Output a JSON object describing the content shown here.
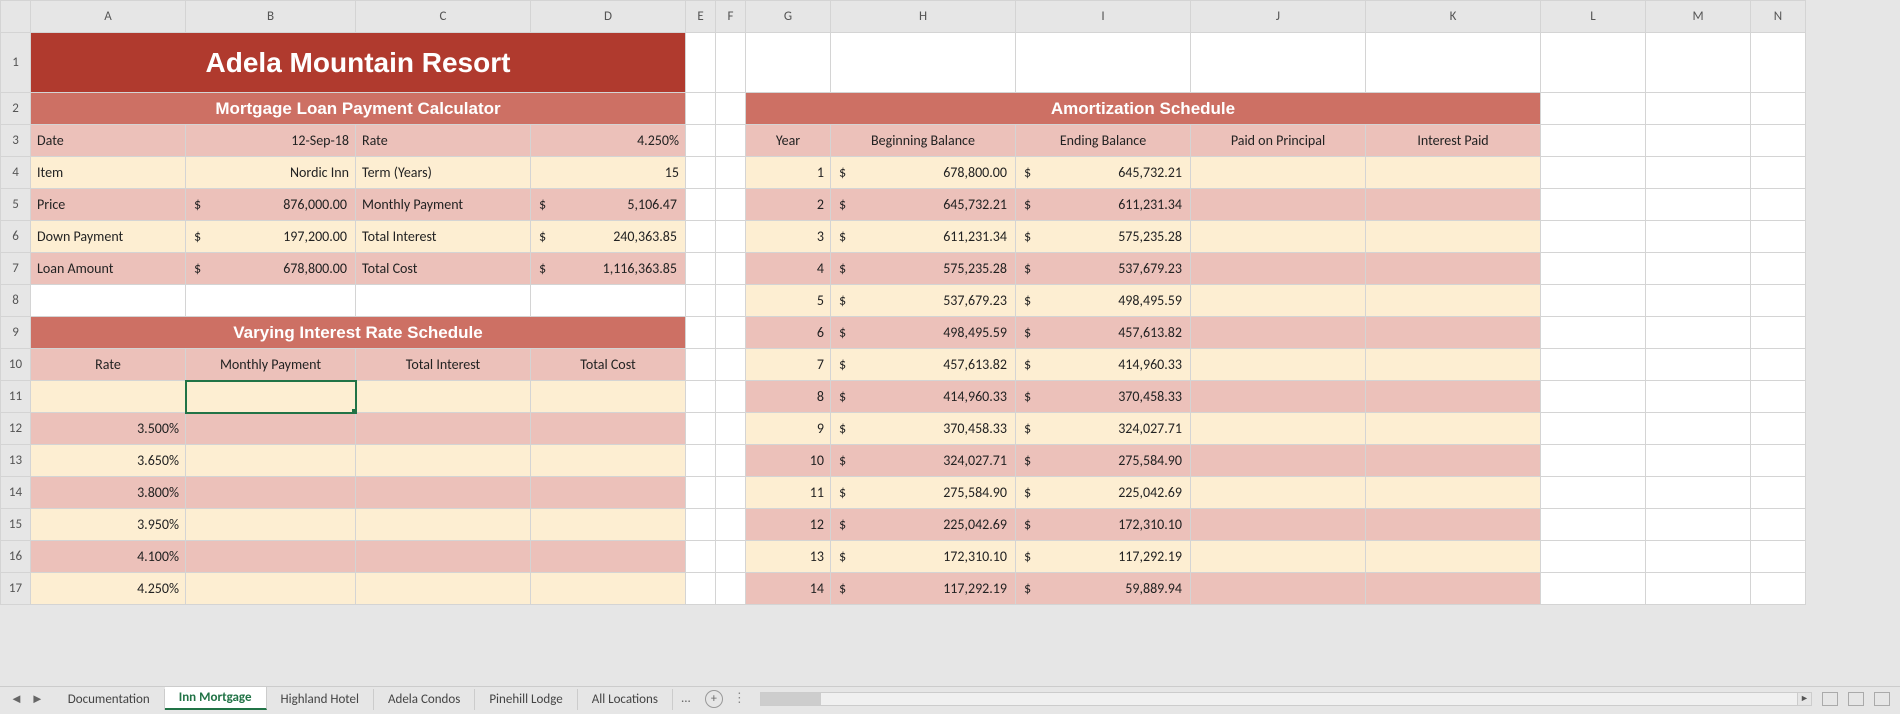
{
  "colHeaders": [
    "A",
    "B",
    "C",
    "D",
    "E",
    "F",
    "G",
    "H",
    "I",
    "J",
    "K",
    "L",
    "M",
    "N"
  ],
  "rowCount": 17,
  "title": "Adela Mountain Resort",
  "mortHeader": "Mortgage Loan Payment Calculator",
  "amortHeader": "Amortization Schedule",
  "varyHeader": "Varying Interest Rate Schedule",
  "labels": {
    "date": "Date",
    "rate": "Rate",
    "item": "Item",
    "term": "Term (Years)",
    "price": "Price",
    "monthly": "Monthly Payment",
    "down": "Down Payment",
    "totint": "Total Interest",
    "loan": "Loan Amount",
    "totcost": "Total Cost",
    "vrate": "Rate",
    "vmonthly": "Monthly Payment",
    "vtotint": "Total Interest",
    "vtotcost": "Total Cost",
    "year": "Year",
    "begbal": "Beginning Balance",
    "endbal": "Ending Balance",
    "paidprin": "Paid on Principal",
    "intpaid": "Interest Paid"
  },
  "mort": {
    "date": "12-Sep-18",
    "rate": "4.250%",
    "item": "Nordic Inn",
    "term": "15",
    "price": "876,000.00",
    "monthly": "5,106.47",
    "down": "197,200.00",
    "totint": "240,363.85",
    "loan": "678,800.00",
    "totcost": "1,116,363.85"
  },
  "rates": [
    "3.500%",
    "3.650%",
    "3.800%",
    "3.950%",
    "4.100%",
    "4.250%"
  ],
  "amort": [
    {
      "y": "1",
      "b": "678,800.00",
      "e": "645,732.21"
    },
    {
      "y": "2",
      "b": "645,732.21",
      "e": "611,231.34"
    },
    {
      "y": "3",
      "b": "611,231.34",
      "e": "575,235.28"
    },
    {
      "y": "4",
      "b": "575,235.28",
      "e": "537,679.23"
    },
    {
      "y": "5",
      "b": "537,679.23",
      "e": "498,495.59"
    },
    {
      "y": "6",
      "b": "498,495.59",
      "e": "457,613.82"
    },
    {
      "y": "7",
      "b": "457,613.82",
      "e": "414,960.33"
    },
    {
      "y": "8",
      "b": "414,960.33",
      "e": "370,458.33"
    },
    {
      "y": "9",
      "b": "370,458.33",
      "e": "324,027.71"
    },
    {
      "y": "10",
      "b": "324,027.71",
      "e": "275,584.90"
    },
    {
      "y": "11",
      "b": "275,584.90",
      "e": "225,042.69"
    },
    {
      "y": "12",
      "b": "225,042.69",
      "e": "172,310.10"
    },
    {
      "y": "13",
      "b": "172,310.10",
      "e": "117,292.19"
    },
    {
      "y": "14",
      "b": "117,292.19",
      "e": "59,889.94"
    }
  ],
  "tabs": [
    "Documentation",
    "Inn Mortgage",
    "Highland Hotel",
    "Adela Condos",
    "Pinehill Lodge",
    "All Locations"
  ],
  "activeTab": 1,
  "tabMore": "...",
  "chart_data": {
    "type": "table",
    "title": "Amortization Schedule",
    "columns": [
      "Year",
      "Beginning Balance",
      "Ending Balance"
    ],
    "rows": [
      [
        1,
        678800.0,
        645732.21
      ],
      [
        2,
        645732.21,
        611231.34
      ],
      [
        3,
        611231.34,
        575235.28
      ],
      [
        4,
        575235.28,
        537679.23
      ],
      [
        5,
        537679.23,
        498495.59
      ],
      [
        6,
        498495.59,
        457613.82
      ],
      [
        7,
        457613.82,
        414960.33
      ],
      [
        8,
        414960.33,
        370458.33
      ],
      [
        9,
        370458.33,
        324027.71
      ],
      [
        10,
        324027.71,
        275584.9
      ],
      [
        11,
        275584.9,
        225042.69
      ],
      [
        12,
        225042.69,
        172310.1
      ],
      [
        13,
        172310.1,
        117292.19
      ],
      [
        14,
        117292.19,
        59889.94
      ]
    ]
  }
}
